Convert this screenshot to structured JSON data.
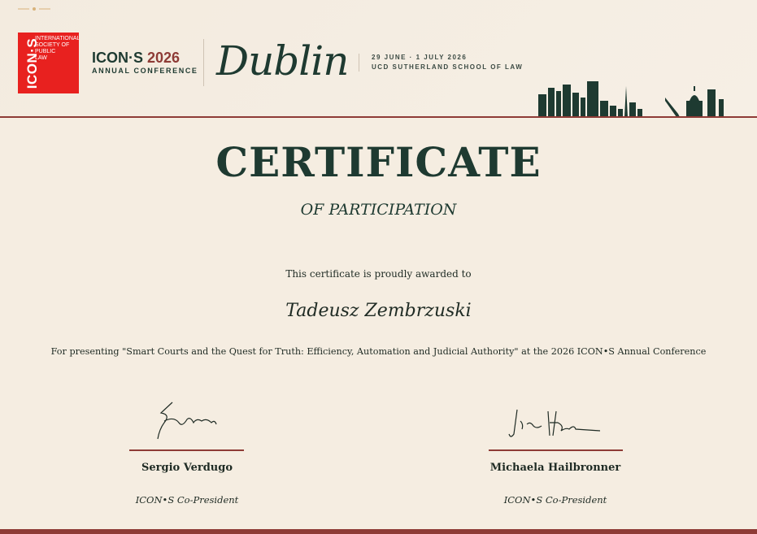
{
  "header": {
    "logo": {
      "vertical_text": "ICON·S",
      "small_lines": [
        "International",
        "Society of",
        "Public",
        "Law"
      ]
    },
    "conference_name": "ICON·S",
    "conference_year": "2026",
    "conference_subtitle": "ANNUAL CONFERENCE",
    "city": "Dublin",
    "dates": "29 JUNE · 1 JULY 2026",
    "venue": "UCD SUTHERLAND SCHOOL OF LAW"
  },
  "certificate": {
    "title": "CERTIFICATE",
    "subtitle": "OF PARTICIPATION",
    "awarded_text": "This certificate is proudly awarded to",
    "recipient": "Tadeusz Zembrzuski",
    "presenting_text": "For presenting \"Smart Courts and the Quest for Truth: Efficiency, Automation and Judicial Authority\" at the 2026 ICON•S Annual Conference"
  },
  "signatories": [
    {
      "name": "Sergio Verdugo",
      "role": "ICON•S Co-President"
    },
    {
      "name": "Michaela Hailbronner",
      "role": "ICON•S Co-President"
    }
  ],
  "colors": {
    "background": "#f5ede1",
    "primary_green": "#1e3a31",
    "accent_red": "#8e3b36",
    "logo_red": "#e8211f",
    "ornament_gold": "#d8b27a"
  }
}
